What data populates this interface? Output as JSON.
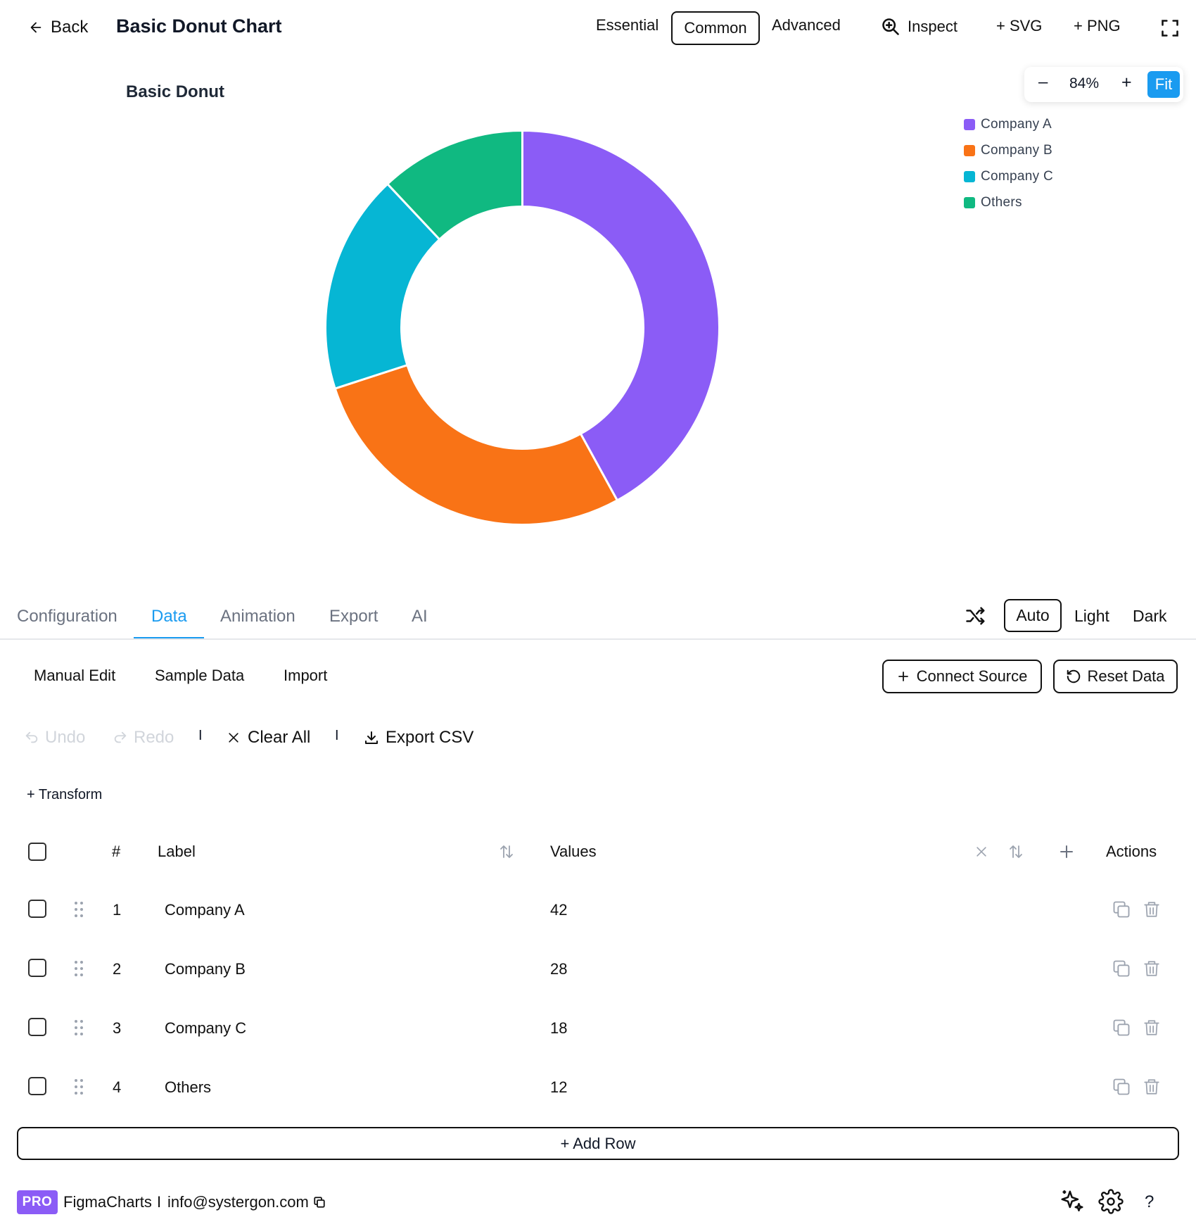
{
  "header": {
    "back_label": "Back",
    "title": "Basic Donut Chart",
    "levels": [
      "Essential",
      "Common",
      "Advanced"
    ],
    "active_level": "Common",
    "inspect_label": "Inspect",
    "svg_label": "+ SVG",
    "png_label": "+ PNG"
  },
  "zoom": {
    "minus_label": "–",
    "level": "84%",
    "plus_label": "+",
    "fit_label": "Fit"
  },
  "chart_data": {
    "type": "pie",
    "variant": "donut",
    "title": "Basic Donut",
    "categories": [
      "Company A",
      "Company B",
      "Company C",
      "Others"
    ],
    "values": [
      42,
      28,
      18,
      12
    ],
    "colors": [
      "#8b5cf6",
      "#f97316",
      "#06b6d4",
      "#10b981"
    ],
    "legend_position": "top-right"
  },
  "tabs": {
    "items": [
      "Configuration",
      "Data",
      "Animation",
      "Export",
      "AI"
    ],
    "active": "Data"
  },
  "theme": {
    "options": [
      "Auto",
      "Light",
      "Dark"
    ],
    "active": "Auto"
  },
  "data_panel": {
    "sub_tabs": [
      "Manual Edit",
      "Sample Data",
      "Import"
    ],
    "connect_source_label": "Connect Source",
    "reset_data_label": "Reset Data",
    "undo_label": "Undo",
    "redo_label": "Redo",
    "separator": "I",
    "clear_all_label": "Clear All",
    "export_csv_label": "Export CSV",
    "transform_label": "+ Transform"
  },
  "table": {
    "headers": {
      "index": "#",
      "label": "Label",
      "values": "Values",
      "actions": "Actions"
    },
    "rows": [
      {
        "index": "1",
        "label": "Company A",
        "value": "42"
      },
      {
        "index": "2",
        "label": "Company B",
        "value": "28"
      },
      {
        "index": "3",
        "label": "Company C",
        "value": "18"
      },
      {
        "index": "4",
        "label": "Others",
        "value": "12"
      }
    ],
    "add_row_label": "+ Add Row"
  },
  "footer": {
    "badge": "PRO",
    "app_name": "FigmaCharts",
    "separator": "I",
    "email": "info@systergon.com",
    "help_label": "?"
  }
}
